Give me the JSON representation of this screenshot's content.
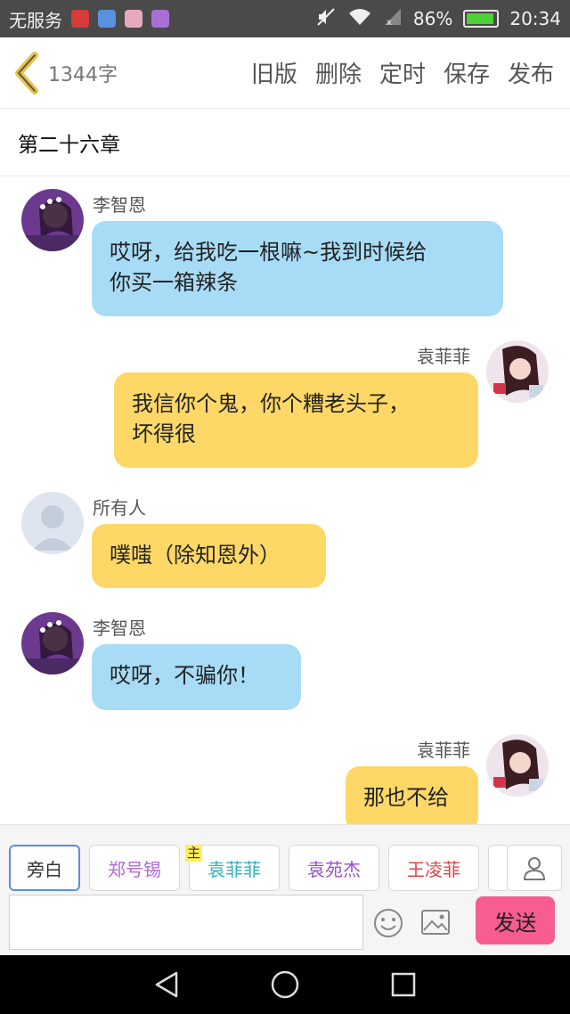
{
  "status_bar": {
    "carrier": "无服务",
    "battery": "86%",
    "battery_level": 0.86,
    "time": "20:34"
  },
  "toolbar": {
    "word_count": "1344字",
    "actions": [
      "旧版",
      "删除",
      "定时",
      "保存",
      "发布"
    ]
  },
  "chapter_title": "第二十六章",
  "messages": [
    {
      "speaker": "李智恩",
      "text_lines": [
        "哎呀，给我吃一根嘛~我到时候给",
        "你买一箱辣条"
      ],
      "side": "left",
      "color": "blue"
    },
    {
      "speaker": "袁菲菲",
      "text_lines": [
        "我信你个鬼，你个糟老头子，",
        "坏得很"
      ],
      "side": "right",
      "color": "yellow"
    },
    {
      "speaker": "所有人",
      "text_lines": [
        "噗嗤（除知恩外）"
      ],
      "side": "left",
      "color": "yellow"
    },
    {
      "speaker": "李智恩",
      "text_lines": [
        "哎呀，不骗你！"
      ],
      "side": "left",
      "color": "blue"
    },
    {
      "speaker": "袁菲菲",
      "text_lines": [
        "那也不给"
      ],
      "side": "right",
      "color": "yellow"
    }
  ],
  "roles": [
    {
      "label": "旁白",
      "color": "#333333"
    },
    {
      "label": "郑号锡",
      "color": "#b06ad6"
    },
    {
      "label": "袁菲菲",
      "color": "#2bb3c4",
      "badge": "主"
    },
    {
      "label": "袁苑杰",
      "color": "#9a4fc9"
    },
    {
      "label": "王凌菲",
      "color": "#e54545"
    }
  ],
  "send_label": "发送",
  "colors": {
    "bubble_blue": "#a8dcf6",
    "bubble_yellow": "#fdd867",
    "send": "#f75d8e",
    "back_arrow": "#e8c341"
  }
}
